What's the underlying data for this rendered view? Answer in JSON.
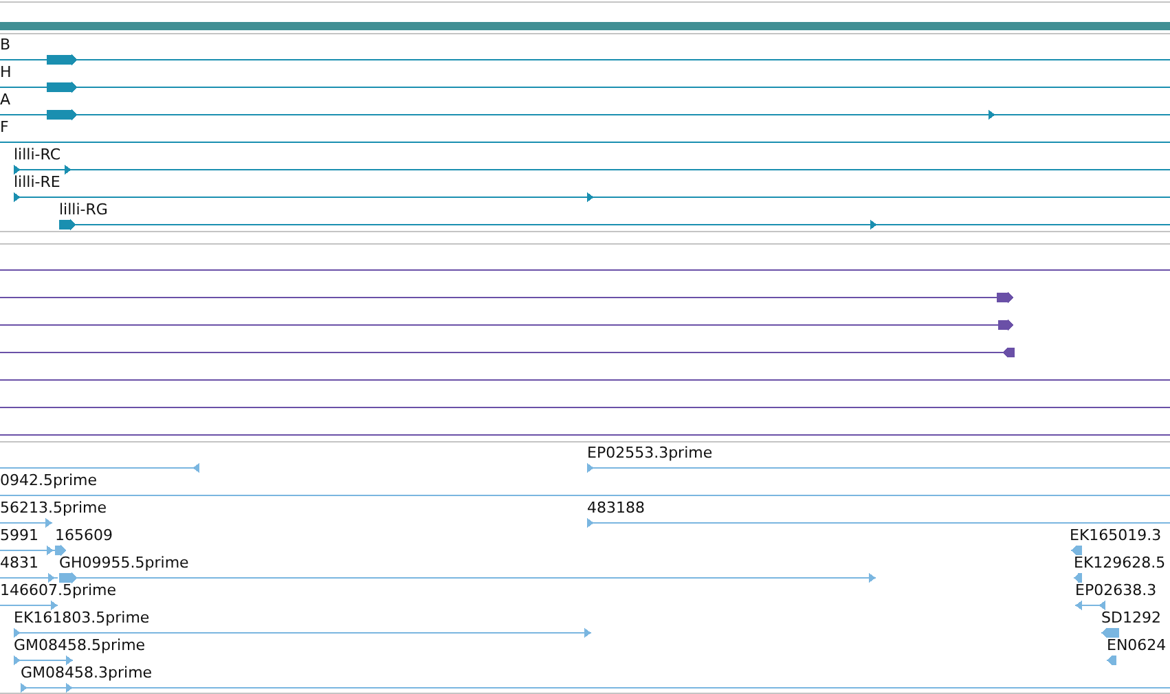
{
  "tracks": [
    {
      "kind": "gene",
      "rows": [
        {
          "features": [
            {
              "kind": "arrow",
              "label": "B",
              "reverse": false
            }
          ]
        },
        {
          "features": [
            {
              "kind": "arrow",
              "label": "H",
              "reverse": false
            }
          ]
        },
        {
          "features": [
            {
              "kind": "arrow",
              "label": "A",
              "reverse": false
            }
          ]
        },
        {
          "features": [
            {
              "kind": "line",
              "label": "F"
            }
          ]
        },
        {
          "features": [
            {
              "kind": "arrow",
              "label": "lilli-RC",
              "reverse": false
            }
          ]
        },
        {
          "features": [
            {
              "kind": "arrow",
              "label": "lilli-RE",
              "reverse": false
            }
          ]
        },
        {
          "features": [
            {
              "kind": "arrow",
              "label": "lilli-RG",
              "reverse": false
            }
          ]
        }
      ]
    },
    {
      "kind": "protein",
      "rows": [
        {
          "features": [
            {
              "kind": "line"
            }
          ]
        },
        {
          "features": [
            {
              "kind": "arrow",
              "reverse": false
            }
          ]
        },
        {
          "features": [
            {
              "kind": "arrow",
              "reverse": false
            }
          ]
        },
        {
          "features": [
            {
              "kind": "arrow",
              "reverse": true
            }
          ]
        },
        {
          "features": [
            {
              "kind": "line"
            }
          ]
        },
        {
          "features": [
            {
              "kind": "line"
            }
          ]
        },
        {
          "features": [
            {
              "kind": "line"
            }
          ]
        }
      ]
    },
    {
      "kind": "est",
      "rows": [
        {
          "features": [
            {
              "kind": "arrow",
              "reverse": true
            },
            {
              "kind": "arrow",
              "label": "EP02553.3prime",
              "reverse": false
            }
          ]
        },
        {
          "features": [
            {
              "kind": "line",
              "label": "0942.5prime"
            }
          ]
        },
        {
          "features": [
            {
              "kind": "arrow",
              "label": "56213.5prime",
              "reverse": false
            },
            {
              "kind": "arrow",
              "label": "483188",
              "reverse": false
            }
          ]
        },
        {
          "features": [
            {
              "kind": "arrow",
              "label": "5991",
              "reverse": false
            },
            {
              "kind": "arrow",
              "label": "165609",
              "reverse": false
            },
            {
              "kind": "arrow",
              "label": "EK165019.3",
              "reverse": true
            }
          ]
        },
        {
          "features": [
            {
              "kind": "arrow",
              "label": "4831",
              "reverse": false
            },
            {
              "kind": "arrow",
              "label": "GH09955.5prime",
              "reverse": false
            },
            {
              "kind": "arrow",
              "label": "EK129628.5",
              "reverse": true
            }
          ]
        },
        {
          "features": [
            {
              "kind": "arrow",
              "label": "146607.5prime",
              "reverse": false
            },
            {
              "kind": "arrow",
              "label": "EP02638.3",
              "reverse": true
            }
          ]
        },
        {
          "features": [
            {
              "kind": "arrow",
              "label": "EK161803.5prime",
              "reverse": false
            },
            {
              "kind": "arrow",
              "label": "SD1292",
              "reverse": true
            }
          ]
        },
        {
          "features": [
            {
              "kind": "arrow",
              "label": "GM08458.5prime",
              "reverse": false
            },
            {
              "kind": "arrow",
              "label": "EN0624",
              "reverse": true
            }
          ]
        },
        {
          "features": [
            {
              "kind": "arrow",
              "label": "GM08458.3prime",
              "reverse": false
            }
          ]
        }
      ]
    }
  ]
}
